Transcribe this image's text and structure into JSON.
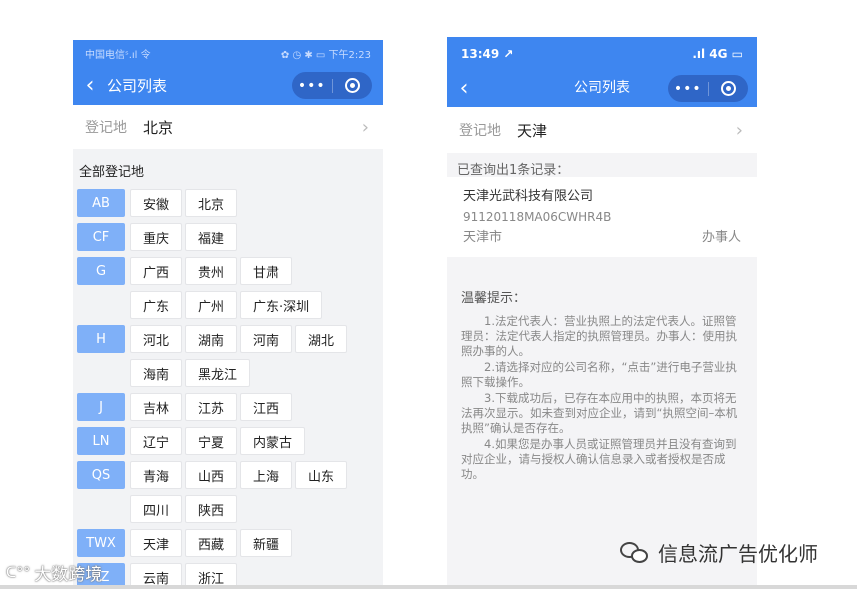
{
  "left": {
    "status": {
      "carrier": "中国电信ˢ.ıl 令",
      "right": "✿ ◷ ✱ ▭ 下午2:23"
    },
    "nav": {
      "back": "‹",
      "title": "公司列表",
      "more": "•••"
    },
    "registration": {
      "label": "登记地",
      "value": "北京",
      "arrow": "›"
    },
    "all_title": "全部登记地",
    "groups": [
      {
        "letter": "AB",
        "cities": [
          "安徽",
          "北京"
        ]
      },
      {
        "letter": "CF",
        "cities": [
          "重庆",
          "福建"
        ]
      },
      {
        "letter": "G",
        "cities": [
          "广西",
          "贵州",
          "甘肃"
        ]
      },
      {
        "letter": "",
        "cities": [
          "广东",
          "广州",
          "广东·深圳"
        ]
      },
      {
        "letter": "H",
        "cities": [
          "河北",
          "湖南",
          "河南",
          "湖北"
        ]
      },
      {
        "letter": "",
        "cities": [
          "海南",
          "黑龙江"
        ]
      },
      {
        "letter": "J",
        "cities": [
          "吉林",
          "江苏",
          "江西"
        ]
      },
      {
        "letter": "LN",
        "cities": [
          "辽宁",
          "宁夏",
          "内蒙古"
        ]
      },
      {
        "letter": "QS",
        "cities": [
          "青海",
          "山西",
          "上海",
          "山东"
        ]
      },
      {
        "letter": "",
        "cities": [
          "四川",
          "陕西"
        ]
      },
      {
        "letter": "TWX",
        "cities": [
          "天津",
          "西藏",
          "新疆"
        ]
      },
      {
        "letter": "YZ",
        "cities": [
          "云南",
          "浙江"
        ]
      }
    ]
  },
  "right": {
    "status": {
      "time": "13:49 ↗",
      "right": ".ıl 4G ▭"
    },
    "nav": {
      "back": "‹",
      "title": "公司列表",
      "more": "•••"
    },
    "registration": {
      "label": "登记地",
      "value": "天津",
      "arrow": "›"
    },
    "query_info": "已查询出1条记录：",
    "result": {
      "name": "天津光武科技有限公司",
      "code": "91120118MA06CWHR4B",
      "city": "天津市",
      "role": "办事人"
    },
    "tips_title": "温馨提示：",
    "tips": [
      "1.法定代表人：营业执照上的法定代表人。证照管理员：法定代表人指定的执照管理员。办事人：使用执照办事的人。",
      "2.请选择对应的公司名称，“点击”进行电子营业执照下载操作。",
      "3.下载成功后，已存在本应用中的执照，本页将无法再次显示。如未查到对应企业，请到“执照空间–本机执照”确认是否存在。",
      "4.如果您是办事人员或证照管理员并且没有查询到对应企业，请与授权人确认信息录入或者授权是否成功。"
    ]
  },
  "watermarks": {
    "left": "大数跨境",
    "right": "信息流广告优化师"
  },
  "colors": {
    "brand_blue": "#3e86f0",
    "letter_blue": "#7fb0f8",
    "capsule": "#2f66c7"
  }
}
